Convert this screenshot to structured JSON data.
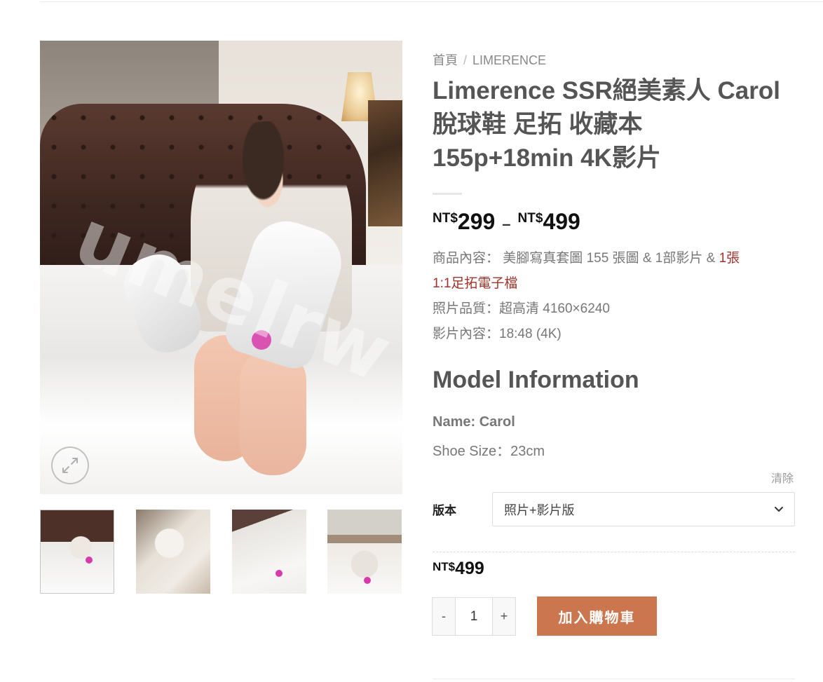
{
  "breadcrumb": {
    "home": "首頁",
    "separator": "/",
    "category": "LIMERENCE"
  },
  "product": {
    "title_line1": "Limerence SSR絕美素人 Carol",
    "title_line2": "脫球鞋 足拓 收藏本",
    "title_line3": "155p+18min 4K影片",
    "price_currency": "NT$",
    "price_min": "299",
    "price_separator": "–",
    "price_max": "499",
    "description": {
      "content_label": "商品內容：",
      "content_value": "美腳寫真套圖 155 張圖 & 1部影片 & ",
      "content_highlight_1": "1張",
      "content_highlight_2": "1:1足拓電子檔",
      "quality": "照片品質：超高清 4160×6240",
      "video": "影片內容：18:48 (4K)"
    },
    "model_heading": "Model Information",
    "model_name": "Name: Carol",
    "model_shoe": "Shoe Size：23cm"
  },
  "image": {
    "watermark": "umelrw"
  },
  "variation": {
    "clear_label": "清除",
    "label": "版本",
    "selected": "照片+影片版"
  },
  "selected_price": {
    "currency": "NT$",
    "amount": "499"
  },
  "cart": {
    "minus": "-",
    "quantity": "1",
    "plus": "+",
    "add_label": "加入購物車",
    "button_color": "#cc7650"
  },
  "icons": {
    "zoom": "expand-icon",
    "dropdown": "chevron-down-icon"
  }
}
